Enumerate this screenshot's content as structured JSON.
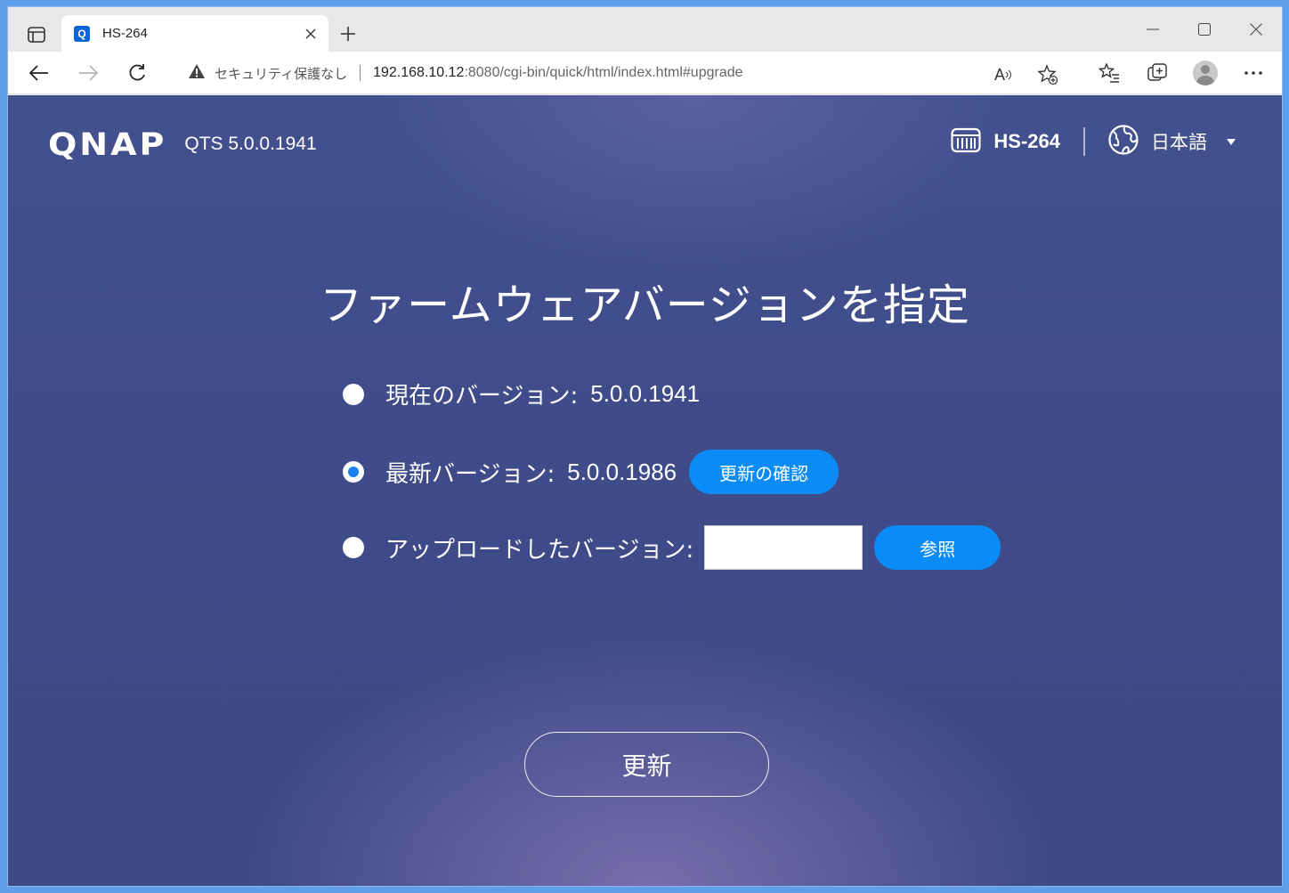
{
  "browser": {
    "tab_title": "HS-264",
    "favicon_letter": "Q",
    "security_text": "セキュリティ保護なし",
    "url_host": "192.168.10.12",
    "url_rest": ":8080/cgi-bin/quick/html/index.html#upgrade",
    "read_aloud_label": "A",
    "accent_color": "#0c66d8"
  },
  "header": {
    "logo_text": "QNAP",
    "qts_version": "QTS 5.0.0.1941",
    "device_name": "HS-264",
    "language": "日本語"
  },
  "main": {
    "title": "ファームウェアバージョンを指定",
    "options": [
      {
        "label": "現在のバージョン:",
        "value": "5.0.0.1941",
        "selected": false
      },
      {
        "label": "最新バージョン:",
        "value": "5.0.0.1986",
        "selected": true,
        "button": "更新の確認"
      },
      {
        "label": "アップロードしたバージョン:",
        "input_value": "",
        "button": "参照",
        "selected": false
      }
    ],
    "update_button": "更新",
    "button_color": "#0a8bf5"
  }
}
